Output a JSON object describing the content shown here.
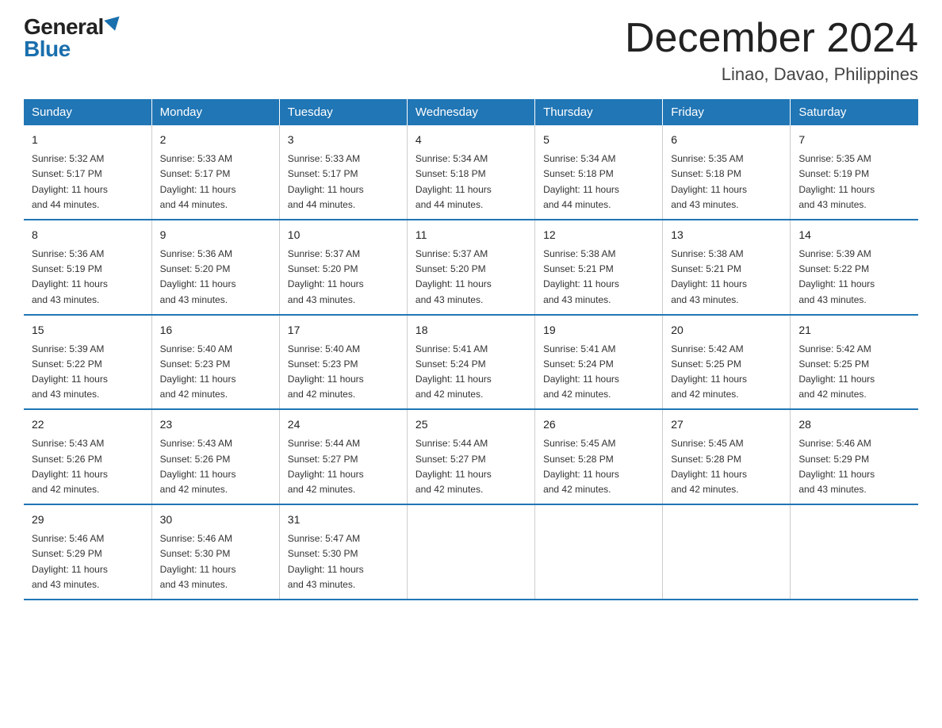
{
  "logo": {
    "general": "General",
    "blue": "Blue"
  },
  "header": {
    "month": "December 2024",
    "location": "Linao, Davao, Philippines"
  },
  "days_of_week": [
    "Sunday",
    "Monday",
    "Tuesday",
    "Wednesday",
    "Thursday",
    "Friday",
    "Saturday"
  ],
  "weeks": [
    [
      {
        "day": "1",
        "sunrise": "5:32 AM",
        "sunset": "5:17 PM",
        "daylight": "11 hours and 44 minutes."
      },
      {
        "day": "2",
        "sunrise": "5:33 AM",
        "sunset": "5:17 PM",
        "daylight": "11 hours and 44 minutes."
      },
      {
        "day": "3",
        "sunrise": "5:33 AM",
        "sunset": "5:17 PM",
        "daylight": "11 hours and 44 minutes."
      },
      {
        "day": "4",
        "sunrise": "5:34 AM",
        "sunset": "5:18 PM",
        "daylight": "11 hours and 44 minutes."
      },
      {
        "day": "5",
        "sunrise": "5:34 AM",
        "sunset": "5:18 PM",
        "daylight": "11 hours and 44 minutes."
      },
      {
        "day": "6",
        "sunrise": "5:35 AM",
        "sunset": "5:18 PM",
        "daylight": "11 hours and 43 minutes."
      },
      {
        "day": "7",
        "sunrise": "5:35 AM",
        "sunset": "5:19 PM",
        "daylight": "11 hours and 43 minutes."
      }
    ],
    [
      {
        "day": "8",
        "sunrise": "5:36 AM",
        "sunset": "5:19 PM",
        "daylight": "11 hours and 43 minutes."
      },
      {
        "day": "9",
        "sunrise": "5:36 AM",
        "sunset": "5:20 PM",
        "daylight": "11 hours and 43 minutes."
      },
      {
        "day": "10",
        "sunrise": "5:37 AM",
        "sunset": "5:20 PM",
        "daylight": "11 hours and 43 minutes."
      },
      {
        "day": "11",
        "sunrise": "5:37 AM",
        "sunset": "5:20 PM",
        "daylight": "11 hours and 43 minutes."
      },
      {
        "day": "12",
        "sunrise": "5:38 AM",
        "sunset": "5:21 PM",
        "daylight": "11 hours and 43 minutes."
      },
      {
        "day": "13",
        "sunrise": "5:38 AM",
        "sunset": "5:21 PM",
        "daylight": "11 hours and 43 minutes."
      },
      {
        "day": "14",
        "sunrise": "5:39 AM",
        "sunset": "5:22 PM",
        "daylight": "11 hours and 43 minutes."
      }
    ],
    [
      {
        "day": "15",
        "sunrise": "5:39 AM",
        "sunset": "5:22 PM",
        "daylight": "11 hours and 43 minutes."
      },
      {
        "day": "16",
        "sunrise": "5:40 AM",
        "sunset": "5:23 PM",
        "daylight": "11 hours and 42 minutes."
      },
      {
        "day": "17",
        "sunrise": "5:40 AM",
        "sunset": "5:23 PM",
        "daylight": "11 hours and 42 minutes."
      },
      {
        "day": "18",
        "sunrise": "5:41 AM",
        "sunset": "5:24 PM",
        "daylight": "11 hours and 42 minutes."
      },
      {
        "day": "19",
        "sunrise": "5:41 AM",
        "sunset": "5:24 PM",
        "daylight": "11 hours and 42 minutes."
      },
      {
        "day": "20",
        "sunrise": "5:42 AM",
        "sunset": "5:25 PM",
        "daylight": "11 hours and 42 minutes."
      },
      {
        "day": "21",
        "sunrise": "5:42 AM",
        "sunset": "5:25 PM",
        "daylight": "11 hours and 42 minutes."
      }
    ],
    [
      {
        "day": "22",
        "sunrise": "5:43 AM",
        "sunset": "5:26 PM",
        "daylight": "11 hours and 42 minutes."
      },
      {
        "day": "23",
        "sunrise": "5:43 AM",
        "sunset": "5:26 PM",
        "daylight": "11 hours and 42 minutes."
      },
      {
        "day": "24",
        "sunrise": "5:44 AM",
        "sunset": "5:27 PM",
        "daylight": "11 hours and 42 minutes."
      },
      {
        "day": "25",
        "sunrise": "5:44 AM",
        "sunset": "5:27 PM",
        "daylight": "11 hours and 42 minutes."
      },
      {
        "day": "26",
        "sunrise": "5:45 AM",
        "sunset": "5:28 PM",
        "daylight": "11 hours and 42 minutes."
      },
      {
        "day": "27",
        "sunrise": "5:45 AM",
        "sunset": "5:28 PM",
        "daylight": "11 hours and 42 minutes."
      },
      {
        "day": "28",
        "sunrise": "5:46 AM",
        "sunset": "5:29 PM",
        "daylight": "11 hours and 43 minutes."
      }
    ],
    [
      {
        "day": "29",
        "sunrise": "5:46 AM",
        "sunset": "5:29 PM",
        "daylight": "11 hours and 43 minutes."
      },
      {
        "day": "30",
        "sunrise": "5:46 AM",
        "sunset": "5:30 PM",
        "daylight": "11 hours and 43 minutes."
      },
      {
        "day": "31",
        "sunrise": "5:47 AM",
        "sunset": "5:30 PM",
        "daylight": "11 hours and 43 minutes."
      },
      null,
      null,
      null,
      null
    ]
  ],
  "labels": {
    "sunrise": "Sunrise:",
    "sunset": "Sunset:",
    "daylight": "Daylight:"
  }
}
